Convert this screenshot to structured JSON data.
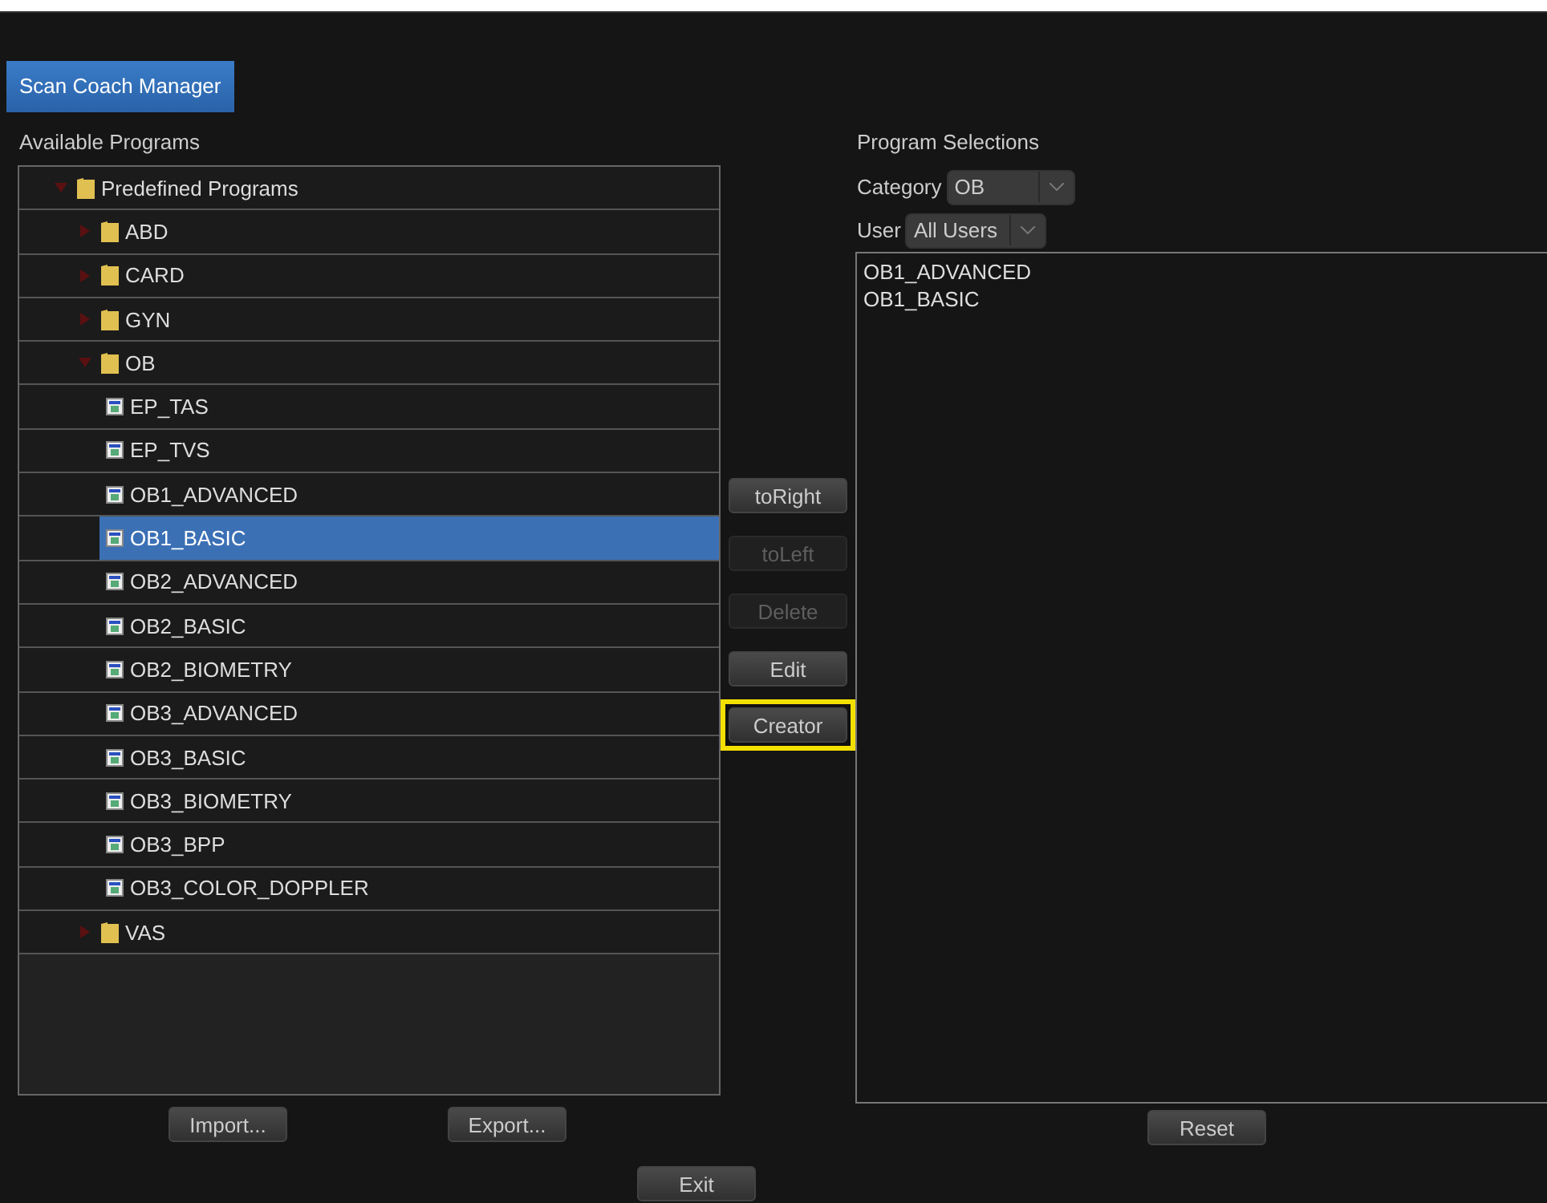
{
  "tab": {
    "label": "Scan Coach Manager",
    "selected": true
  },
  "available": {
    "title": "Available Programs",
    "tree": [
      {
        "label": "Predefined Programs",
        "kind": "folder",
        "expanded": true,
        "selected": false,
        "children": [
          {
            "label": "ABD",
            "kind": "folder",
            "expanded": false,
            "selected": false
          },
          {
            "label": "CARD",
            "kind": "folder",
            "expanded": false,
            "selected": false
          },
          {
            "label": "GYN",
            "kind": "folder",
            "expanded": false,
            "selected": false
          },
          {
            "label": "OB",
            "kind": "folder",
            "expanded": true,
            "selected": false,
            "children": [
              {
                "label": "EP_TAS",
                "kind": "program",
                "selected": false
              },
              {
                "label": "EP_TVS",
                "kind": "program",
                "selected": false
              },
              {
                "label": "OB1_ADVANCED",
                "kind": "program",
                "selected": false
              },
              {
                "label": "OB1_BASIC",
                "kind": "program",
                "selected": true
              },
              {
                "label": "OB2_ADVANCED",
                "kind": "program",
                "selected": false
              },
              {
                "label": "OB2_BASIC",
                "kind": "program",
                "selected": false
              },
              {
                "label": "OB2_BIOMETRY",
                "kind": "program",
                "selected": false
              },
              {
                "label": "OB3_ADVANCED",
                "kind": "program",
                "selected": false
              },
              {
                "label": "OB3_BASIC",
                "kind": "program",
                "selected": false
              },
              {
                "label": "OB3_BIOMETRY",
                "kind": "program",
                "selected": false
              },
              {
                "label": "OB3_BPP",
                "kind": "program",
                "selected": false
              },
              {
                "label": "OB3_COLOR_DOPPLER",
                "kind": "program",
                "selected": false
              }
            ]
          },
          {
            "label": "VAS",
            "kind": "folder",
            "expanded": false,
            "selected": false
          }
        ]
      }
    ],
    "buttons": [
      "Import...",
      "Export..."
    ]
  },
  "actions": [
    {
      "label": "toRight",
      "disabled": false,
      "highlighted": false
    },
    {
      "label": "toLeft",
      "disabled": true,
      "highlighted": false
    },
    {
      "label": "Delete",
      "disabled": true,
      "highlighted": false
    },
    {
      "label": "Edit",
      "disabled": false,
      "highlighted": false
    },
    {
      "label": "Creator",
      "disabled": false,
      "highlighted": true
    }
  ],
  "selections": {
    "title": "Program Selections",
    "category": {
      "label": "Category",
      "value": "OB"
    },
    "user": {
      "label": "User",
      "value": "All Users"
    },
    "items": [
      "OB1_ADVANCED",
      "OB1_BASIC"
    ],
    "buttons": [
      "Reset"
    ]
  },
  "exit": "Exit"
}
